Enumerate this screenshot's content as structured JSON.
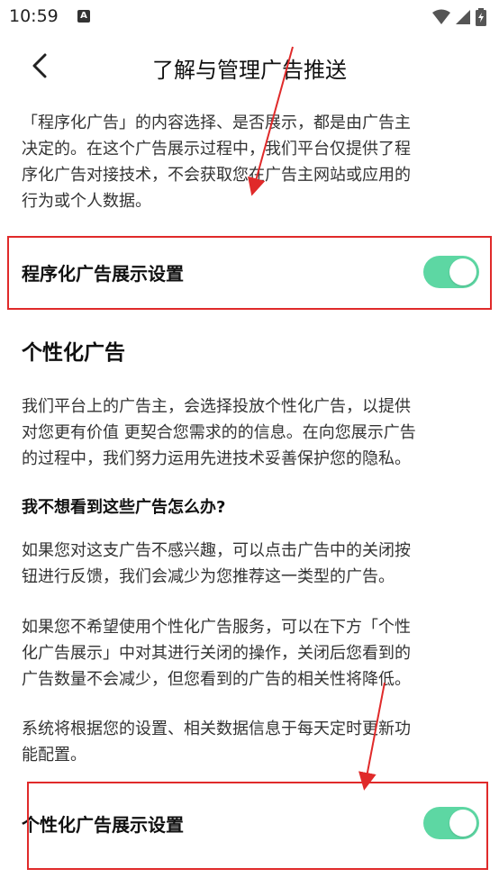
{
  "status_bar": {
    "time": "10:59",
    "notification_letter": "A"
  },
  "header": {
    "title": "了解与管理广告推送"
  },
  "intro": [
    "「程序化广告」的内容选择、是否展示，都是由广告主",
    "决定的。在这个广告展示过程中，我们平台仅提供了程",
    "序化广告对接技术，不会获取您在广告主网站或应用的",
    "行为或个人数据。"
  ],
  "setting1": {
    "label": "程序化广告展示设置",
    "enabled": true
  },
  "personalized": {
    "title": "个性化广告",
    "para1": [
      "我们平台上的广告主，会选择投放个性化广告，以提供",
      "对您更有价值 更契合您需求的的信息。在向您展示广告",
      "的过程中，我们努力运用先进技术妥善保护您的隐私。"
    ],
    "question": "我不想看到这些广告怎么办?",
    "para2": [
      "如果您对这支广告不感兴趣，可以点击广告中的关闭按",
      "钮进行反馈，我们会减少为您推荐这一类型的广告。"
    ],
    "para3": [
      "如果您不希望使用个性化广告服务，可以在下方「个性",
      "化广告展示」中对其进行关闭的操作，关闭后您看到的",
      "广告数量不会减少，但您看到的广告的相关性将降低。"
    ],
    "para4": [
      "系统将根据您的设置、相关数据信息于每天定时更新功",
      "能配置。"
    ]
  },
  "setting2": {
    "label": "个性化广告展示设置",
    "enabled": true
  },
  "colors": {
    "toggle_on": "#5dd7a3",
    "annotation_red": "#e02a2a"
  }
}
